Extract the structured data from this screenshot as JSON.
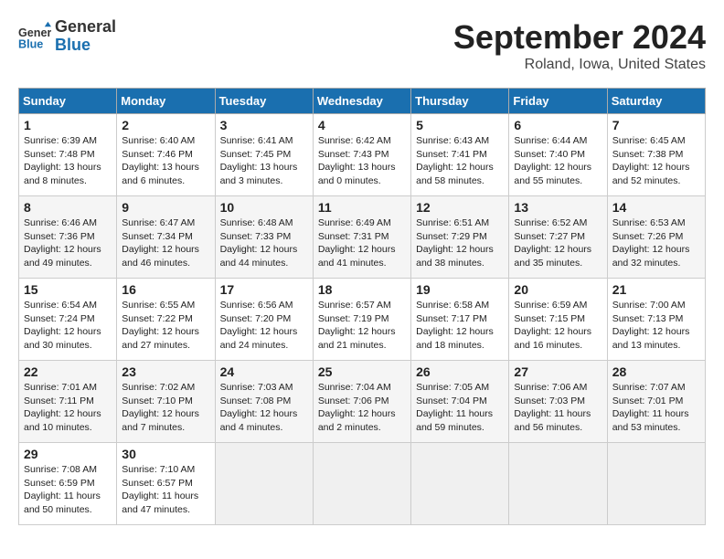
{
  "header": {
    "logo_line1": "General",
    "logo_line2": "Blue",
    "title": "September 2024",
    "subtitle": "Roland, Iowa, United States"
  },
  "weekdays": [
    "Sunday",
    "Monday",
    "Tuesday",
    "Wednesday",
    "Thursday",
    "Friday",
    "Saturday"
  ],
  "weeks": [
    [
      {
        "day": "1",
        "lines": [
          "Sunrise: 6:39 AM",
          "Sunset: 7:48 PM",
          "Daylight: 13 hours",
          "and 8 minutes."
        ]
      },
      {
        "day": "2",
        "lines": [
          "Sunrise: 6:40 AM",
          "Sunset: 7:46 PM",
          "Daylight: 13 hours",
          "and 6 minutes."
        ]
      },
      {
        "day": "3",
        "lines": [
          "Sunrise: 6:41 AM",
          "Sunset: 7:45 PM",
          "Daylight: 13 hours",
          "and 3 minutes."
        ]
      },
      {
        "day": "4",
        "lines": [
          "Sunrise: 6:42 AM",
          "Sunset: 7:43 PM",
          "Daylight: 13 hours",
          "and 0 minutes."
        ]
      },
      {
        "day": "5",
        "lines": [
          "Sunrise: 6:43 AM",
          "Sunset: 7:41 PM",
          "Daylight: 12 hours",
          "and 58 minutes."
        ]
      },
      {
        "day": "6",
        "lines": [
          "Sunrise: 6:44 AM",
          "Sunset: 7:40 PM",
          "Daylight: 12 hours",
          "and 55 minutes."
        ]
      },
      {
        "day": "7",
        "lines": [
          "Sunrise: 6:45 AM",
          "Sunset: 7:38 PM",
          "Daylight: 12 hours",
          "and 52 minutes."
        ]
      }
    ],
    [
      {
        "day": "8",
        "lines": [
          "Sunrise: 6:46 AM",
          "Sunset: 7:36 PM",
          "Daylight: 12 hours",
          "and 49 minutes."
        ]
      },
      {
        "day": "9",
        "lines": [
          "Sunrise: 6:47 AM",
          "Sunset: 7:34 PM",
          "Daylight: 12 hours",
          "and 46 minutes."
        ]
      },
      {
        "day": "10",
        "lines": [
          "Sunrise: 6:48 AM",
          "Sunset: 7:33 PM",
          "Daylight: 12 hours",
          "and 44 minutes."
        ]
      },
      {
        "day": "11",
        "lines": [
          "Sunrise: 6:49 AM",
          "Sunset: 7:31 PM",
          "Daylight: 12 hours",
          "and 41 minutes."
        ]
      },
      {
        "day": "12",
        "lines": [
          "Sunrise: 6:51 AM",
          "Sunset: 7:29 PM",
          "Daylight: 12 hours",
          "and 38 minutes."
        ]
      },
      {
        "day": "13",
        "lines": [
          "Sunrise: 6:52 AM",
          "Sunset: 7:27 PM",
          "Daylight: 12 hours",
          "and 35 minutes."
        ]
      },
      {
        "day": "14",
        "lines": [
          "Sunrise: 6:53 AM",
          "Sunset: 7:26 PM",
          "Daylight: 12 hours",
          "and 32 minutes."
        ]
      }
    ],
    [
      {
        "day": "15",
        "lines": [
          "Sunrise: 6:54 AM",
          "Sunset: 7:24 PM",
          "Daylight: 12 hours",
          "and 30 minutes."
        ]
      },
      {
        "day": "16",
        "lines": [
          "Sunrise: 6:55 AM",
          "Sunset: 7:22 PM",
          "Daylight: 12 hours",
          "and 27 minutes."
        ]
      },
      {
        "day": "17",
        "lines": [
          "Sunrise: 6:56 AM",
          "Sunset: 7:20 PM",
          "Daylight: 12 hours",
          "and 24 minutes."
        ]
      },
      {
        "day": "18",
        "lines": [
          "Sunrise: 6:57 AM",
          "Sunset: 7:19 PM",
          "Daylight: 12 hours",
          "and 21 minutes."
        ]
      },
      {
        "day": "19",
        "lines": [
          "Sunrise: 6:58 AM",
          "Sunset: 7:17 PM",
          "Daylight: 12 hours",
          "and 18 minutes."
        ]
      },
      {
        "day": "20",
        "lines": [
          "Sunrise: 6:59 AM",
          "Sunset: 7:15 PM",
          "Daylight: 12 hours",
          "and 16 minutes."
        ]
      },
      {
        "day": "21",
        "lines": [
          "Sunrise: 7:00 AM",
          "Sunset: 7:13 PM",
          "Daylight: 12 hours",
          "and 13 minutes."
        ]
      }
    ],
    [
      {
        "day": "22",
        "lines": [
          "Sunrise: 7:01 AM",
          "Sunset: 7:11 PM",
          "Daylight: 12 hours",
          "and 10 minutes."
        ]
      },
      {
        "day": "23",
        "lines": [
          "Sunrise: 7:02 AM",
          "Sunset: 7:10 PM",
          "Daylight: 12 hours",
          "and 7 minutes."
        ]
      },
      {
        "day": "24",
        "lines": [
          "Sunrise: 7:03 AM",
          "Sunset: 7:08 PM",
          "Daylight: 12 hours",
          "and 4 minutes."
        ]
      },
      {
        "day": "25",
        "lines": [
          "Sunrise: 7:04 AM",
          "Sunset: 7:06 PM",
          "Daylight: 12 hours",
          "and 2 minutes."
        ]
      },
      {
        "day": "26",
        "lines": [
          "Sunrise: 7:05 AM",
          "Sunset: 7:04 PM",
          "Daylight: 11 hours",
          "and 59 minutes."
        ]
      },
      {
        "day": "27",
        "lines": [
          "Sunrise: 7:06 AM",
          "Sunset: 7:03 PM",
          "Daylight: 11 hours",
          "and 56 minutes."
        ]
      },
      {
        "day": "28",
        "lines": [
          "Sunrise: 7:07 AM",
          "Sunset: 7:01 PM",
          "Daylight: 11 hours",
          "and 53 minutes."
        ]
      }
    ],
    [
      {
        "day": "29",
        "lines": [
          "Sunrise: 7:08 AM",
          "Sunset: 6:59 PM",
          "Daylight: 11 hours",
          "and 50 minutes."
        ]
      },
      {
        "day": "30",
        "lines": [
          "Sunrise: 7:10 AM",
          "Sunset: 6:57 PM",
          "Daylight: 11 hours",
          "and 47 minutes."
        ]
      },
      null,
      null,
      null,
      null,
      null
    ]
  ]
}
